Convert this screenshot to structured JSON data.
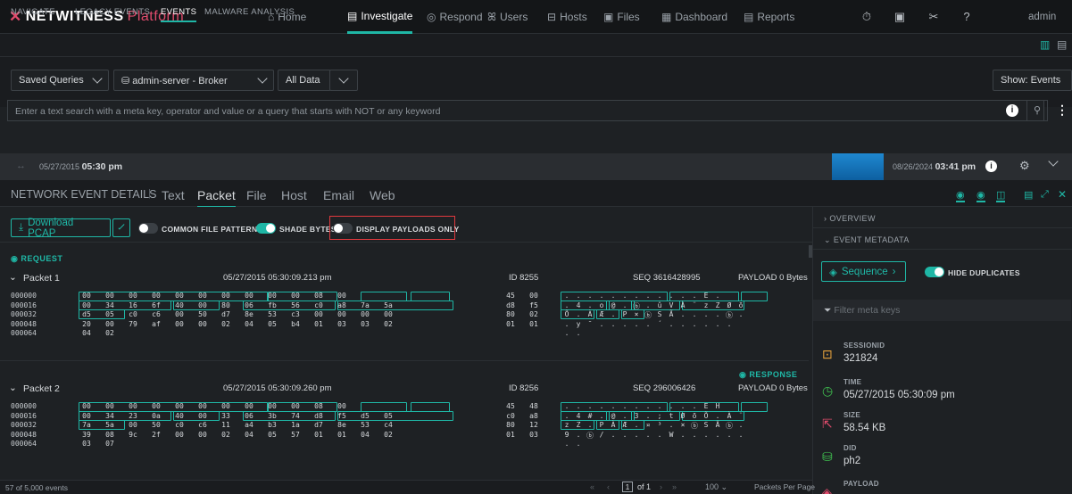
{
  "app": {
    "brand": "NETWITNESS",
    "brand_suffix": "Platform",
    "user": "admin"
  },
  "topnav": [
    {
      "label": "Home",
      "icon": "home-icon",
      "glyph": "⌂"
    },
    {
      "label": "Investigate",
      "icon": "investigate-icon",
      "glyph": "▤"
    },
    {
      "label": "Respond",
      "icon": "respond-icon",
      "glyph": "◎"
    },
    {
      "label": "Users",
      "icon": "users-icon",
      "glyph": "ꕤ"
    },
    {
      "label": "Hosts",
      "icon": "hosts-icon",
      "glyph": "⊟"
    },
    {
      "label": "Files",
      "icon": "files-icon",
      "glyph": "▣"
    },
    {
      "label": "Dashboard",
      "icon": "dashboard-icon",
      "glyph": "▦"
    },
    {
      "label": "Reports",
      "icon": "reports-icon",
      "glyph": "▤"
    }
  ],
  "subnav": [
    "NAVIGATE",
    "LEGACY EVENTS",
    "EVENTS",
    "MALWARE ANALYSIS"
  ],
  "query": {
    "saved": "Saved Queries",
    "service": "admin-server - Broker",
    "range": "All Data",
    "show": "Show: Events",
    "placeholder": "Enter a text search with a meta key, operator and value or a query that starts with NOT or any keyword"
  },
  "timeline": {
    "start_date": "05/27/2015",
    "start_time": "05:30 pm",
    "end_date": "08/26/2024",
    "end_time": "03:41 pm"
  },
  "detail_tabs": {
    "title": "NETWORK EVENT DETAILS",
    "tabs": [
      "Text",
      "Packet",
      "File",
      "Host",
      "Email",
      "Web"
    ]
  },
  "toolbar": {
    "download": "Download PCAP",
    "common": "COMMON FILE PATTERNS",
    "shade": "SHADE BYTES",
    "payloads": "DISPLAY PAYLOADS ONLY"
  },
  "request_label": "REQUEST",
  "response_label": "RESPONSE",
  "packets": [
    {
      "name": "Packet 1",
      "time": "05/27/2015 05:30:09.213 pm",
      "id": "ID 8255",
      "seq": "SEQ 3616428995",
      "payload": "PAYLOAD 0 Bytes",
      "rows": [
        {
          "off": "000000",
          "hex": [
            "00",
            "00",
            "00",
            "00",
            "00",
            "00",
            "00",
            "00",
            "00",
            "00",
            "08",
            "00",
            "45",
            "00"
          ],
          "asc": [
            ".",
            ".",
            ".",
            ".",
            ".",
            ".",
            ".",
            ".",
            ".",
            ".",
            ".",
            ".",
            "E",
            "."
          ]
        },
        {
          "off": "000016",
          "hex": [
            "00",
            "34",
            "16",
            "6f",
            "40",
            "00",
            "80",
            "06",
            "fb",
            "56",
            "c0",
            "a8",
            "7a",
            "5a",
            "d8",
            "f5"
          ],
          "asc": [
            ".",
            "4",
            ".",
            "o",
            "@",
            ".",
            "ⓑ",
            ".",
            "û",
            "V",
            "À",
            "¨",
            "z",
            "Z",
            "Ø",
            "õ"
          ]
        },
        {
          "off": "000032",
          "hex": [
            "d5",
            "05",
            "c0",
            "c6",
            "00",
            "50",
            "d7",
            "8e",
            "53",
            "c3",
            "00",
            "00",
            "00",
            "00",
            "80",
            "02"
          ],
          "asc": [
            "Õ",
            ".",
            "À",
            "Æ",
            ".",
            "P",
            "×",
            "ⓑ",
            "S",
            "Ã",
            ".",
            ".",
            ".",
            ".",
            "ⓑ",
            "."
          ]
        },
        {
          "off": "000048",
          "hex": [
            "20",
            "00",
            "79",
            "af",
            "00",
            "00",
            "02",
            "04",
            "05",
            "b4",
            "01",
            "03",
            "03",
            "02",
            "01",
            "01"
          ],
          "asc": [
            ".",
            "y",
            "¯",
            ".",
            ".",
            ".",
            ".",
            ".",
            "´",
            ".",
            ".",
            ".",
            ".",
            ".",
            ".",
            " "
          ]
        },
        {
          "off": "000064",
          "hex": [
            "04",
            "02"
          ],
          "asc": [
            ".",
            "."
          ]
        }
      ]
    },
    {
      "name": "Packet 2",
      "time": "05/27/2015 05:30:09.260 pm",
      "id": "ID 8256",
      "seq": "SEQ 296006426",
      "payload": "PAYLOAD 0 Bytes",
      "rows": [
        {
          "off": "000000",
          "hex": [
            "00",
            "00",
            "00",
            "00",
            "00",
            "00",
            "00",
            "00",
            "00",
            "00",
            "08",
            "00",
            "45",
            "48"
          ],
          "asc": [
            ".",
            ".",
            ".",
            ".",
            ".",
            ".",
            ".",
            ".",
            ".",
            ".",
            ".",
            ".",
            "E",
            "H"
          ]
        },
        {
          "off": "000016",
          "hex": [
            "00",
            "34",
            "23",
            "0a",
            "40",
            "00",
            "33",
            "06",
            "3b",
            "74",
            "d8",
            "f5",
            "d5",
            "05",
            "c0",
            "a8"
          ],
          "asc": [
            ".",
            "4",
            "#",
            ".",
            "@",
            ".",
            "3",
            ".",
            ";",
            "t",
            "Ø",
            "õ",
            "Õ",
            ".",
            "À",
            "¨"
          ]
        },
        {
          "off": "000032",
          "hex": [
            "7a",
            "5a",
            "00",
            "50",
            "c0",
            "c6",
            "11",
            "a4",
            "b3",
            "1a",
            "d7",
            "8e",
            "53",
            "c4",
            "80",
            "12"
          ],
          "asc": [
            "z",
            "Z",
            ".",
            "P",
            "À",
            "Æ",
            ".",
            "¤",
            "³",
            ".",
            "×",
            "ⓑ",
            "S",
            "Ä",
            "ⓑ",
            "."
          ]
        },
        {
          "off": "000048",
          "hex": [
            "39",
            "08",
            "9c",
            "2f",
            "00",
            "00",
            "02",
            "04",
            "05",
            "57",
            "01",
            "01",
            "04",
            "02",
            "01",
            "03"
          ],
          "asc": [
            "9",
            ".",
            "ⓑ",
            "/",
            ".",
            ".",
            ".",
            ".",
            ".",
            "W",
            ".",
            ".",
            ".",
            ".",
            ".",
            "."
          ]
        },
        {
          "off": "000064",
          "hex": [
            "03",
            "07"
          ],
          "asc": [
            ".",
            "."
          ]
        }
      ]
    }
  ],
  "sidebar": {
    "overview": "OVERVIEW",
    "metadata": "EVENT METADATA",
    "sequence": "Sequence",
    "hide_dup": "HIDE DUPLICATES",
    "filter_placeholder": "Filter meta keys",
    "meta": [
      {
        "key": "SESSIONID",
        "value": "321824",
        "icon": "session-icon",
        "color": "#e6a23c"
      },
      {
        "key": "TIME",
        "value": "05/27/2015 05:30:09 pm",
        "icon": "clock-icon",
        "color": "#3fbf4f"
      },
      {
        "key": "SIZE",
        "value": "58.54 KB",
        "icon": "size-icon",
        "color": "#e04b6c"
      },
      {
        "key": "DID",
        "value": "ph2",
        "icon": "did-icon",
        "color": "#3fbf4f"
      },
      {
        "key": "PAYLOAD",
        "value": "",
        "icon": "payload-icon",
        "color": "#e04b6c"
      }
    ]
  },
  "footer": {
    "count": "57 of 5,000 events",
    "page": "1",
    "of": "of 1",
    "per_page": "100",
    "per_page_label": "Packets Per Page"
  },
  "colors": {
    "accent": "#1fb7a6",
    "highlight": "#e0393e",
    "bg": "#1e2124"
  }
}
